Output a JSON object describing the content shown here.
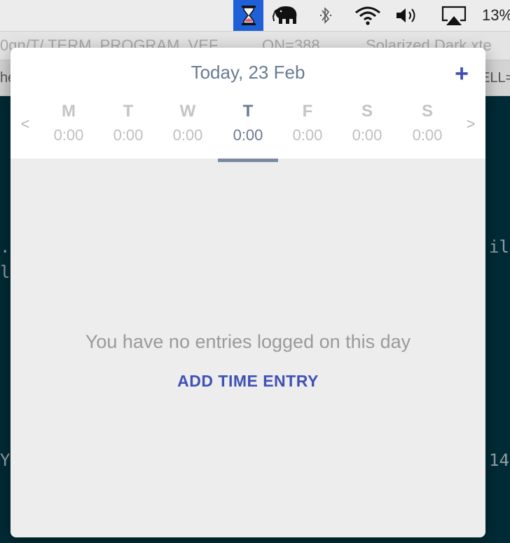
{
  "menubar": {
    "icons": [
      "hourglass-icon",
      "elephant-icon",
      "bluetooth-icon",
      "wifi-icon",
      "volume-icon",
      "airplay-icon"
    ],
    "battery_text": "13%",
    "accent": "#1f5fd8"
  },
  "terminal": {
    "title_left": "0gn/T/ TERM_PROGRAM_VEF",
    "title_mid": "ON=388",
    "title_right": "Solarized Dark xte",
    "tab_left": "he",
    "tab_right": "ELL=",
    "frag_1_left": ".b",
    "frag_2_left": "la",
    "frag_1_right": "il",
    "frag_3_left": "Y",
    "frag_3_right": "14"
  },
  "popover": {
    "date_title": "Today, 23 Feb",
    "add_label": "+",
    "prev_label": "<",
    "next_label": ">",
    "days": [
      {
        "letter": "M",
        "hours": "0:00"
      },
      {
        "letter": "T",
        "hours": "0:00"
      },
      {
        "letter": "W",
        "hours": "0:00"
      },
      {
        "letter": "T",
        "hours": "0:00"
      },
      {
        "letter": "F",
        "hours": "0:00"
      },
      {
        "letter": "S",
        "hours": "0:00"
      },
      {
        "letter": "S",
        "hours": "0:00"
      }
    ],
    "active_day_index": 3,
    "empty_message": "You have no entries logged on this day",
    "add_entry_label": "ADD TIME ENTRY",
    "accent": "#3f51b5"
  }
}
